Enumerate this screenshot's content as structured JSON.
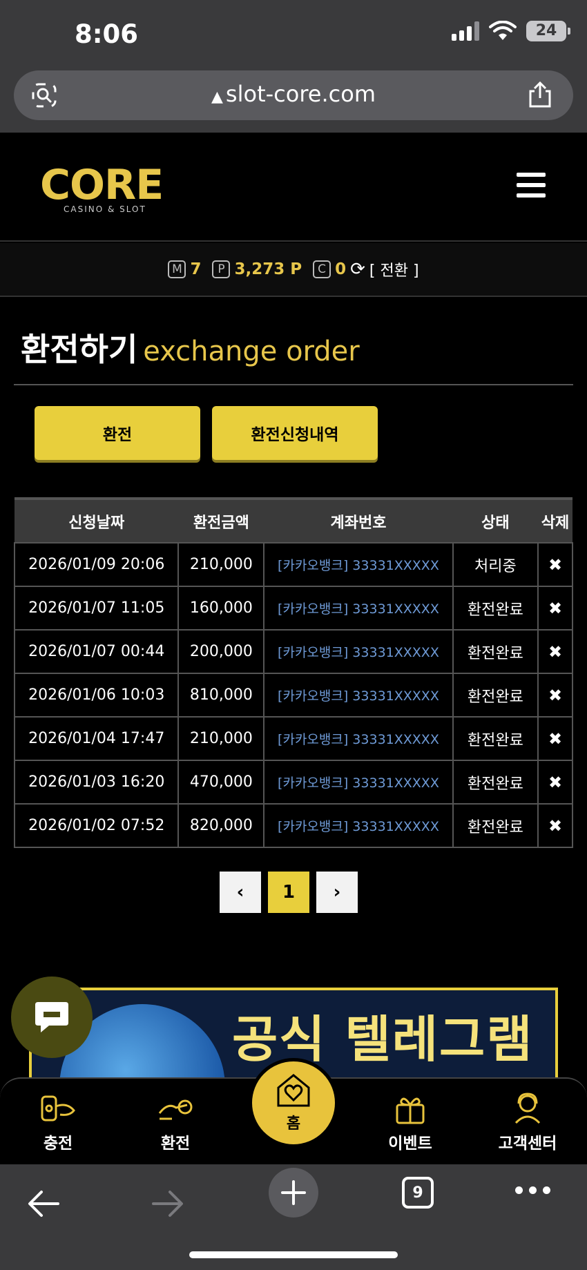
{
  "status_bar": {
    "time": "8:06",
    "battery": "24"
  },
  "browser": {
    "url": "slot-core.com"
  },
  "site": {
    "logo_main": "CORE",
    "logo_sub": "CASINO & SLOT"
  },
  "points": {
    "m_badge": "M",
    "m_value": "7",
    "p_badge": "P",
    "p_value": "3,273 P",
    "c_badge": "C",
    "c_value": "0",
    "convert_label": "[ 전환 ]"
  },
  "page_title": {
    "ko": "환전하기",
    "en": "exchange order"
  },
  "tabs": {
    "exchange": "환전",
    "history": "환전신청내역"
  },
  "table": {
    "headers": [
      "신청날짜",
      "환전금액",
      "계좌번호",
      "상태",
      "삭제"
    ],
    "rows": [
      {
        "date": "2026/01/09 20:06",
        "amount": "210,000",
        "account": "[카카오뱅크] 33331XXXXX",
        "status": "처리중"
      },
      {
        "date": "2026/01/07 11:05",
        "amount": "160,000",
        "account": "[카카오뱅크] 33331XXXXX",
        "status": "환전완료"
      },
      {
        "date": "2026/01/07 00:44",
        "amount": "200,000",
        "account": "[카카오뱅크] 33331XXXXX",
        "status": "환전완료"
      },
      {
        "date": "2026/01/06 10:03",
        "amount": "810,000",
        "account": "[카카오뱅크] 33331XXXXX",
        "status": "환전완료"
      },
      {
        "date": "2026/01/04 17:47",
        "amount": "210,000",
        "account": "[카카오뱅크] 33331XXXXX",
        "status": "환전완료"
      },
      {
        "date": "2026/01/03 16:20",
        "amount": "470,000",
        "account": "[카카오뱅크] 33331XXXXX",
        "status": "환전완료"
      },
      {
        "date": "2026/01/02 07:52",
        "amount": "820,000",
        "account": "[카카오뱅크] 33331XXXXX",
        "status": "환전완료"
      }
    ],
    "delete_symbol": "✖"
  },
  "pagination": {
    "prev": "‹",
    "current": "1",
    "next": "›"
  },
  "banner": {
    "text": "공식 텔레그램"
  },
  "bottom_nav": {
    "charge": "충전",
    "exchange": "환전",
    "home": "홈",
    "event": "이벤트",
    "support": "고객센터"
  },
  "safari": {
    "tabs_count": "9"
  },
  "colors": {
    "accent": "#e8cf3c",
    "link": "#6e9ad6"
  }
}
